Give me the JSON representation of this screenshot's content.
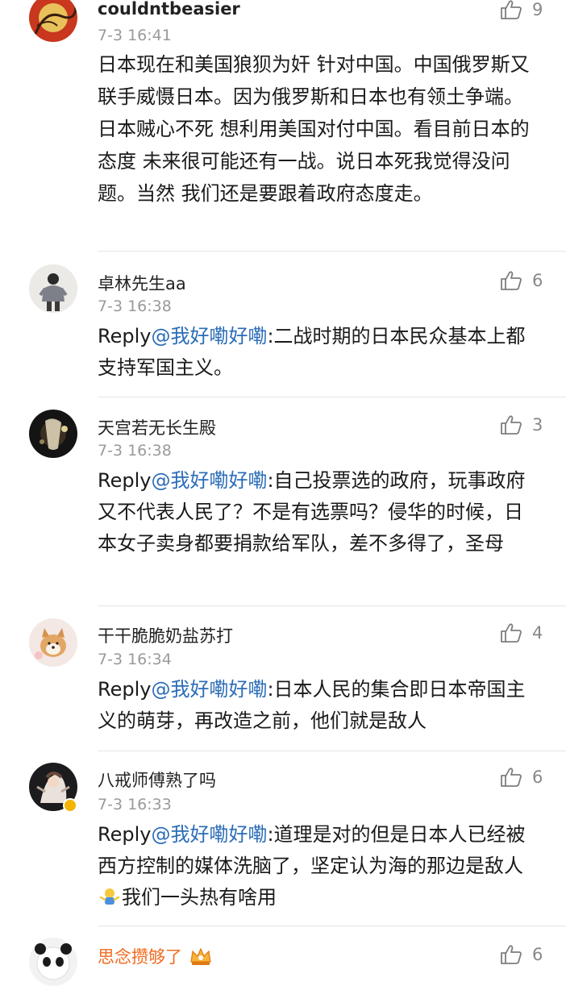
{
  "comments": [
    {
      "username": "couldntbeasier",
      "time": "7-3 16:41",
      "likes": "9",
      "text": "日本现在和美国狼狈为奸 针对中国。中国俄罗斯又联手威慑日本。因为俄罗斯和日本也有领土争端。日本贼心不死 想利用美国对付中国。看目前日本的态度 未来很可能还有一战。说日本死我觉得没问题。当然 我们还是要跟着政府态度走。"
    },
    {
      "username": "卓林先生aa",
      "time": "7-3 16:38",
      "likes": "6",
      "reply_label": "Reply",
      "mention": "@我好嘞好嘞",
      "text": ":二战时期的日本民众基本上都支持军国主义。"
    },
    {
      "username": "天宫若无长生殿",
      "time": "7-3 16:38",
      "likes": "3",
      "reply_label": "Reply",
      "mention": "@我好嘞好嘞",
      "text": ":自己投票选的政府，玩事政府又不代表人民了？不是有选票吗？侵华的时候，日本女子卖身都要捐款给军队，差不多得了，圣母"
    },
    {
      "username": "干干脆脆奶盐苏打",
      "time": "7-3 16:34",
      "likes": "4",
      "reply_label": "Reply",
      "mention": "@我好嘞好嘞",
      "text": ":日本人民的集合即日本帝国主义的萌芽，再改造之前，他们就是敌人"
    },
    {
      "username": "八戒师傅熟了吗",
      "time": "7-3 16:33",
      "likes": "6",
      "reply_label": "Reply",
      "mention": "@我好嘞好嘞",
      "text": ":道理是对的但是日本人已经被西方控制的媒体洗脑了，坚定认为海的那边是敌人",
      "text_after_emoji": "我们一头热有啥用",
      "emoji": "emoji-shrug-icon"
    },
    {
      "username": "思念攒够了",
      "likes": "6",
      "badge": "crown-badge-icon"
    }
  ],
  "colors": {
    "mention": "#2a6cb7",
    "vip_name": "#f06a1e",
    "meta": "#9a9a9a",
    "divider": "#e6e6e6"
  }
}
